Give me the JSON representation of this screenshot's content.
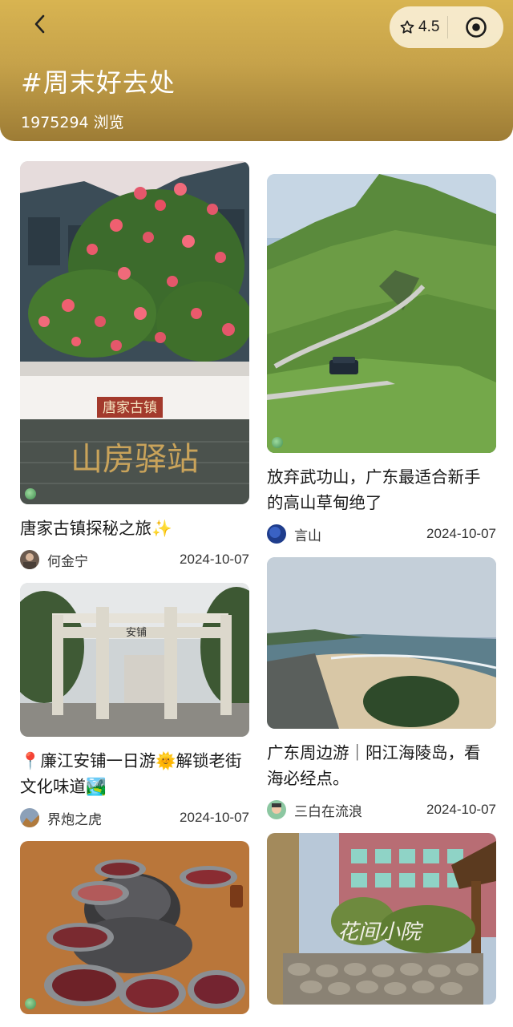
{
  "header": {
    "rating": "4.5",
    "topic_title": "#周末好去处",
    "views": "1975294 浏览"
  },
  "cards_left": [
    {
      "image_text": [
        "唐家古镇",
        "山房驿站"
      ],
      "title": "唐家古镇探秘之旅✨",
      "author": "何金宁",
      "date": "2024-10-07"
    },
    {
      "image_text": [
        "安铺"
      ],
      "title": "📍廉江安铺一日游🌞解锁老街文化味道🏞️",
      "author": "界炮之虎",
      "date": "2024-10-07"
    },
    {
      "image_text": [],
      "title": "",
      "author": "",
      "date": ""
    }
  ],
  "cards_right": [
    {
      "image_text": [],
      "title": "放弃武功山，广东最适合新手的高山草甸绝了",
      "author": "言山",
      "date": "2024-10-07"
    },
    {
      "image_text": [],
      "title": "广东周边游｜阳江海陵岛，看海必经点。",
      "author": "三白在流浪",
      "date": "2024-10-07"
    },
    {
      "image_text": [
        "花间小院"
      ],
      "title": "",
      "author": "",
      "date": ""
    }
  ]
}
